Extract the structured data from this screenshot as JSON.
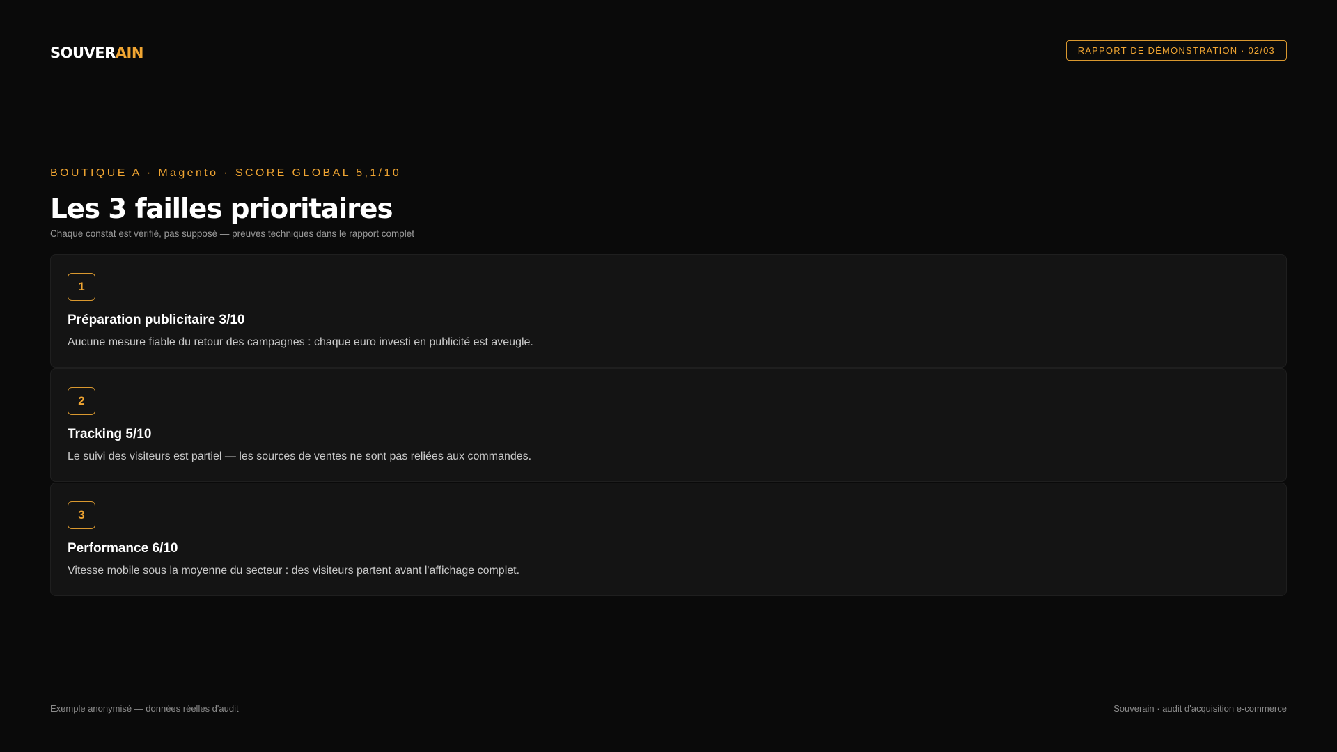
{
  "header": {
    "logo_part1": "SOUVER",
    "logo_part2": "AIN",
    "badge": "RAPPORT DE DÉMONSTRATION · 02/03"
  },
  "intro": {
    "eyebrow": "BOUTIQUE A · Magento · SCORE GLOBAL 5,1/10",
    "title": "Les 3 failles prioritaires",
    "subtitle": "Chaque constat est vérifié, pas supposé — preuves techniques dans le rapport complet"
  },
  "failles": [
    {
      "number": "1",
      "title": "Préparation publicitaire 3/10",
      "text": "Aucune mesure fiable du retour des campagnes : chaque euro investi en publicité est aveugle."
    },
    {
      "number": "2",
      "title": "Tracking 5/10",
      "text": "Le suivi des visiteurs est partiel — les sources de ventes ne sont pas reliées aux commandes."
    },
    {
      "number": "3",
      "title": "Performance 6/10",
      "text": "Vitesse mobile sous la moyenne du secteur : des visiteurs partent avant l'affichage complet."
    }
  ],
  "footer": {
    "left": "Exemple anonymisé — données réelles d'audit",
    "right": "Souverain · audit d'acquisition e-commerce"
  },
  "colors": {
    "background": "#0a0a0a",
    "card": "#141414",
    "accent": "#f0a532"
  }
}
